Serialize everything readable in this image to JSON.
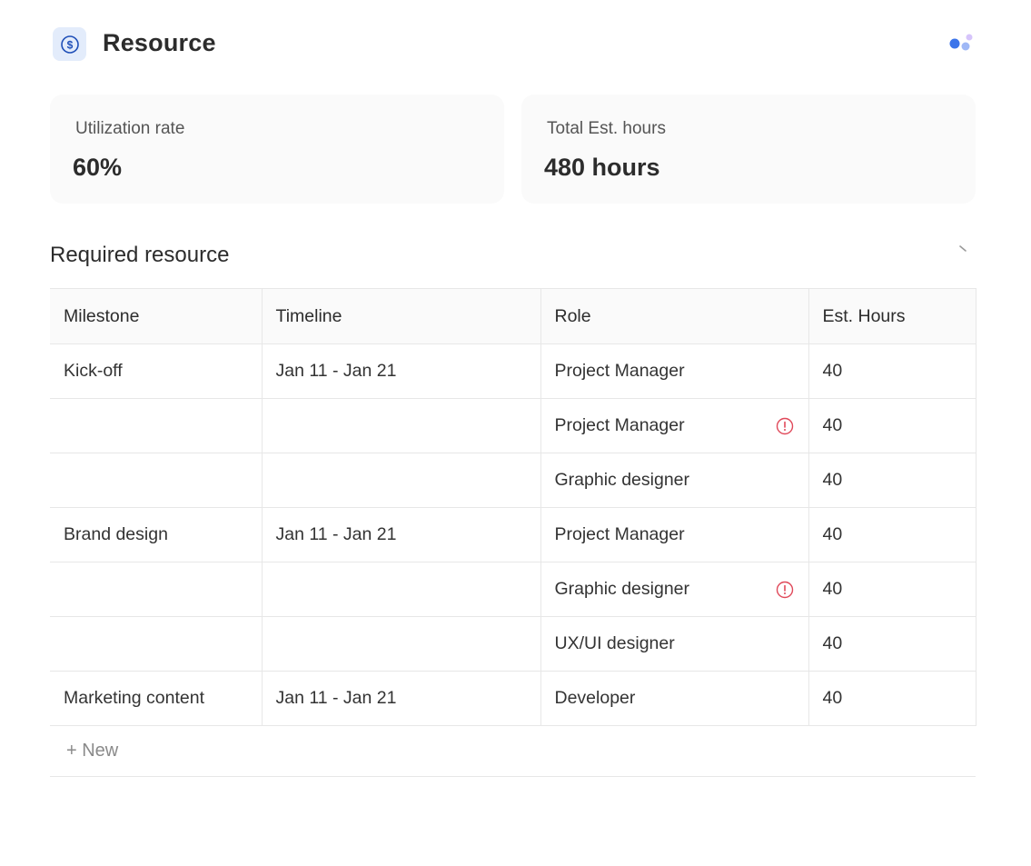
{
  "header": {
    "title": "Resource",
    "icon": "dollar-circle-icon",
    "menu_icon": "dots-icon"
  },
  "stats": [
    {
      "label": "Utilization rate",
      "value": "60%"
    },
    {
      "label": "Total Est. hours",
      "value": "480 hours"
    }
  ],
  "section": {
    "title": "Required resource",
    "action_icon": "collapse-icon"
  },
  "table": {
    "columns": [
      "Milestone",
      "Timeline",
      "Role",
      "Est. Hours"
    ],
    "rows": [
      {
        "milestone": "Kick-off",
        "timeline": "Jan 11 - Jan 21",
        "role": "Project Manager",
        "hours": "40",
        "alert": false
      },
      {
        "milestone": "",
        "timeline": "",
        "role": "Project Manager",
        "hours": "40",
        "alert": true
      },
      {
        "milestone": "",
        "timeline": "",
        "role": "Graphic designer",
        "hours": "40",
        "alert": false
      },
      {
        "milestone": "Brand design",
        "timeline": "Jan 11 - Jan 21",
        "role": "Project Manager",
        "hours": "40",
        "alert": false
      },
      {
        "milestone": "",
        "timeline": "",
        "role": "Graphic designer",
        "hours": "40",
        "alert": true
      },
      {
        "milestone": "",
        "timeline": "",
        "role": "UX/UI designer",
        "hours": "40",
        "alert": false
      },
      {
        "milestone": "Marketing content",
        "timeline": "Jan 11 - Jan 21",
        "role": "Developer",
        "hours": "40",
        "alert": false
      }
    ],
    "new_label": "+ New"
  },
  "colors": {
    "accent": "#2f6fe4",
    "alert": "#e0495a",
    "icon_bg": "#e3ecfb",
    "card_bg": "#fafafa",
    "border": "#e7e7e7"
  }
}
